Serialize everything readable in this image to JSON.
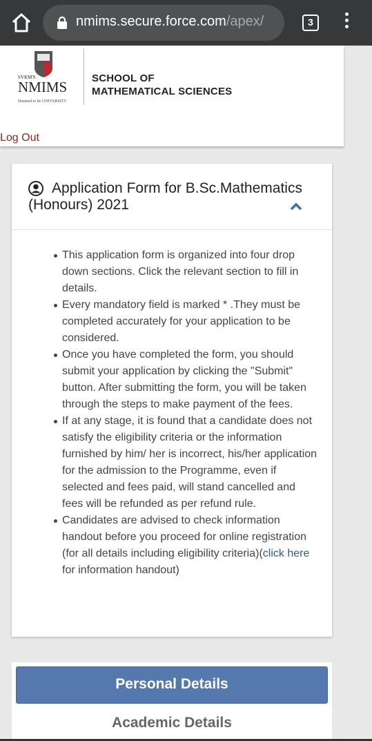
{
  "browser": {
    "url_main": "nmims.secure.force.com",
    "url_dim": "/apex/",
    "tab_count": "3"
  },
  "header": {
    "logo_small": "SVKM'S",
    "logo_main": "NMIMS",
    "logo_sub": "Deemed to be UNIVERSITY",
    "school_line1": "SCHOOL OF",
    "school_line2": "MATHEMATICAL SCIENCES",
    "logout_label": "Log Out"
  },
  "form": {
    "title": "Application Form for B.Sc.Mathematics (Honours) 2021",
    "instructions": [
      "This application form is organized into four drop down sections. Click the relevant section to fill in details.",
      "Every mandatory field is marked * .They must be completed accurately for your application to be considered.",
      "Once you have completed the form, you should submit your application by clicking the \"Submit\" button. After submitting the form, you will be taken through the steps to make payment of the fees.",
      "If at any stage, it is found that a candidate does not satisfy the eligibility criteria or the information furnished by him/ her is incorrect, his/her application for the admission to the Programme, even if selected and fees paid, will stand cancelled and fees will be refunded as per refund rule."
    ],
    "last_instruction_pre": "Candidates are advised to check information handout before you proceed for online registration (for all details including eligibility criteria)(",
    "last_instruction_link": "click here",
    "last_instruction_post": " for information handout)"
  },
  "sections": {
    "personal": "Personal Details",
    "academic": "Academic Details"
  },
  "colors": {
    "chrome_bg": "#37383a",
    "personal_button": "#5579ae",
    "logout": "#8b2a1f",
    "link": "#2c5b8f"
  }
}
